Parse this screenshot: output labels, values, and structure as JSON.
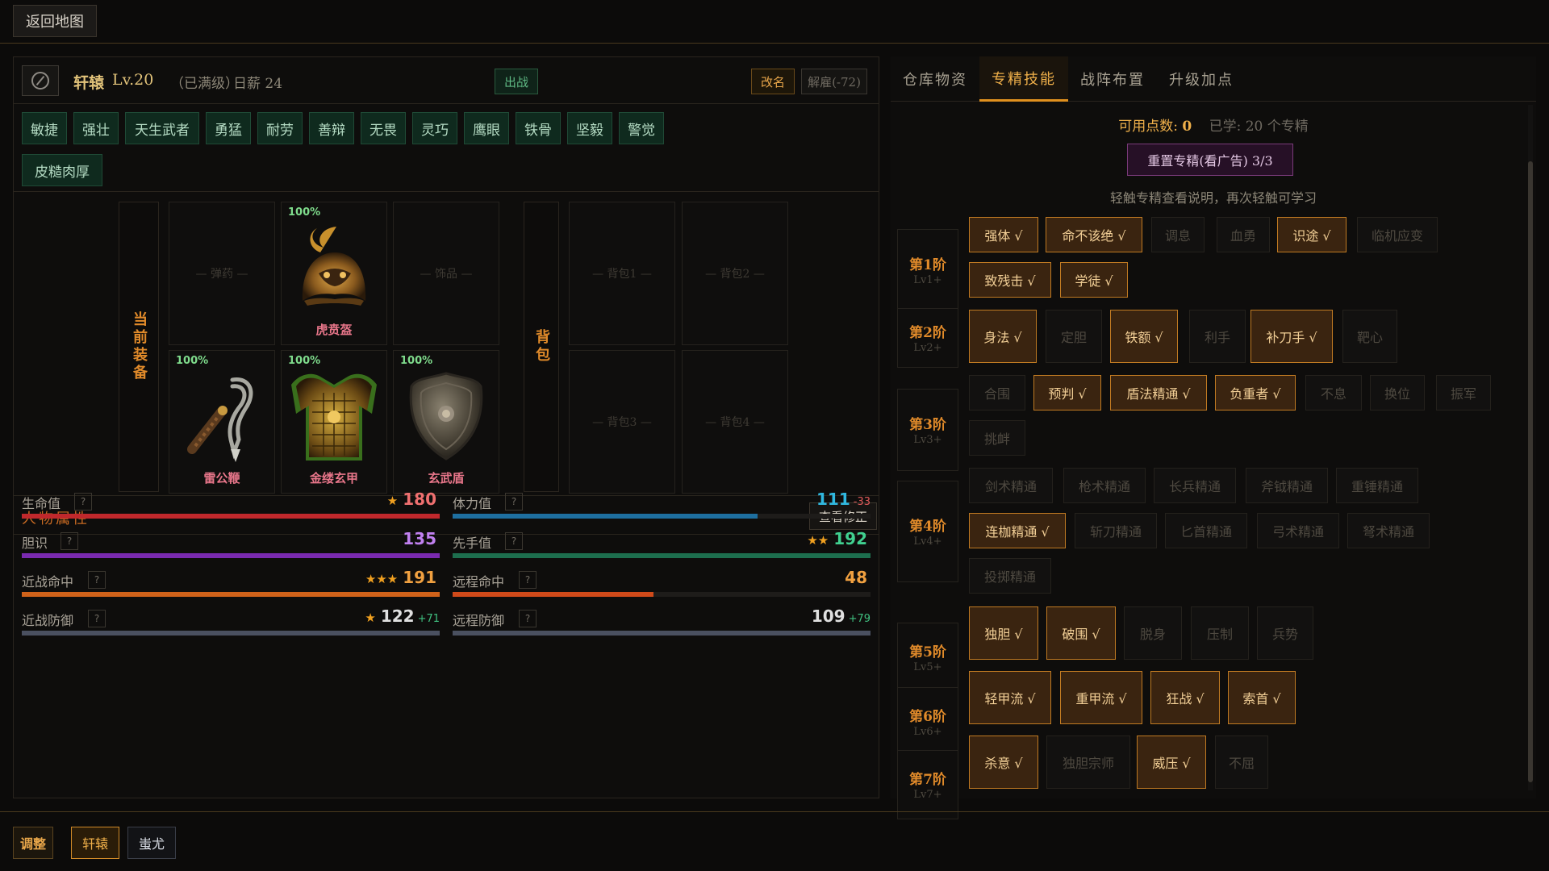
{
  "topbar": {
    "back_label": "返回地图"
  },
  "hero": {
    "name": "轩辕",
    "level": "Lv.20",
    "max_note": "（已满级）",
    "pay": "日薪 24",
    "deploy_label": "出战",
    "rename_label": "改名",
    "dismiss_label": "解雇(-72)"
  },
  "traits": [
    "敏捷",
    "强壮",
    "天生武者",
    "勇猛",
    "耐劳",
    "善辩",
    "无畏",
    "灵巧",
    "鹰眼",
    "铁骨",
    "坚毅",
    "警觉",
    "皮糙肉厚"
  ],
  "equipment": {
    "current_label": "当前装备",
    "backpack_label": "背包",
    "slots": {
      "ammo": "— 弹药 —",
      "helmet": {
        "name": "虎贲盔",
        "durability": "100%"
      },
      "accessory": "— 饰品 —",
      "weapon": {
        "name": "雷公鞭",
        "durability": "100%"
      },
      "armor": {
        "name": "金缕玄甲",
        "durability": "100%"
      },
      "shield": {
        "name": "玄武盾",
        "durability": "100%"
      }
    },
    "backpack": [
      "— 背包1 —",
      "— 背包2 —",
      "— 背包3 —",
      "— 背包4 —"
    ]
  },
  "attributes": {
    "title": "人物属性",
    "view_mod_label": "查看修正",
    "help": "?",
    "stats": [
      {
        "label": "生命值",
        "stars": "★",
        "value": "180",
        "mod": "",
        "fill": 1.0,
        "color": "#f07070",
        "bar": "#c0282c"
      },
      {
        "label": "体力值",
        "stars": "",
        "value": "111",
        "mod": "-33",
        "fill": 0.73,
        "color": "#30b8e0",
        "bar": "#1e6fa0"
      },
      {
        "label": "胆识",
        "stars": "",
        "value": "135",
        "mod": "",
        "fill": 1.0,
        "color": "#c080f0",
        "bar": "#7a2ab0"
      },
      {
        "label": "先手值",
        "stars": "★★",
        "value": "192",
        "mod": "",
        "fill": 1.0,
        "color": "#40d090",
        "bar": "#1d6e4e"
      },
      {
        "label": "近战命中",
        "stars": "★★★",
        "value": "191",
        "mod": "",
        "fill": 1.0,
        "color": "#f0a040",
        "bar": "#d0621a"
      },
      {
        "label": "远程命中",
        "stars": "",
        "value": "48",
        "mod": "",
        "fill": 0.48,
        "color": "#f0a040",
        "bar": "#d04a1a"
      },
      {
        "label": "近战防御",
        "stars": "★",
        "value": "122",
        "mod": "+71",
        "fill": 1.0,
        "color": "#e0e0e0",
        "bar": "#4a5060"
      },
      {
        "label": "远程防御",
        "stars": "",
        "value": "109",
        "mod": "+79",
        "fill": 1.0,
        "color": "#e0e0e0",
        "bar": "#4a5060"
      }
    ]
  },
  "tabs": [
    "仓库物资",
    "专精技能",
    "战阵布置",
    "升级加点"
  ],
  "perks": {
    "points_label": "可用点数: ",
    "points_value": "0",
    "learned": "已学: 20 个专精",
    "reset_label": "重置专精(看广告) 3/3",
    "hint": "轻触专精查看说明，再次轻触可学习",
    "tiers": [
      {
        "name": "第1阶",
        "req": "Lv1+"
      },
      {
        "name": "第2阶",
        "req": "Lv2+"
      },
      {
        "name": "第3阶",
        "req": "Lv3+"
      },
      {
        "name": "第4阶",
        "req": "Lv4+"
      },
      {
        "name": "第5阶",
        "req": "Lv5+"
      },
      {
        "name": "第6阶",
        "req": "Lv6+"
      },
      {
        "name": "第7阶",
        "req": "Lv7+"
      }
    ],
    "skills": {
      "t1": [
        "强体 √",
        "命不该绝 √",
        "调息",
        "血勇",
        "识途 √",
        "临机应变",
        "致残击 √",
        "学徒 √"
      ],
      "t2": [
        "身法 √",
        "定胆",
        "铁额 √",
        "利手",
        "补刀手 √",
        "靶心"
      ],
      "t3": [
        "合围",
        "预判 √",
        "盾法精通 √",
        "负重者 √",
        "不息",
        "换位",
        "振军",
        "挑衅"
      ],
      "t4": [
        "剑术精通",
        "枪术精通",
        "长兵精通",
        "斧钺精通",
        "重锤精通",
        "连枷精通 √",
        "斩刀精通",
        "匕首精通",
        "弓术精通",
        "弩术精通",
        "投掷精通"
      ],
      "t5": [
        "独胆 √",
        "破围 √",
        "脱身",
        "压制",
        "兵势"
      ],
      "t6": [
        "轻甲流 √",
        "重甲流 √",
        "狂战 √",
        "索首 √"
      ],
      "t7": [
        "杀意 √",
        "独胆宗师",
        "威压 √",
        "不屈"
      ]
    }
  },
  "bottombar": {
    "adjust": "调整",
    "hero1": "轩辕",
    "hero2": "蚩尤"
  }
}
